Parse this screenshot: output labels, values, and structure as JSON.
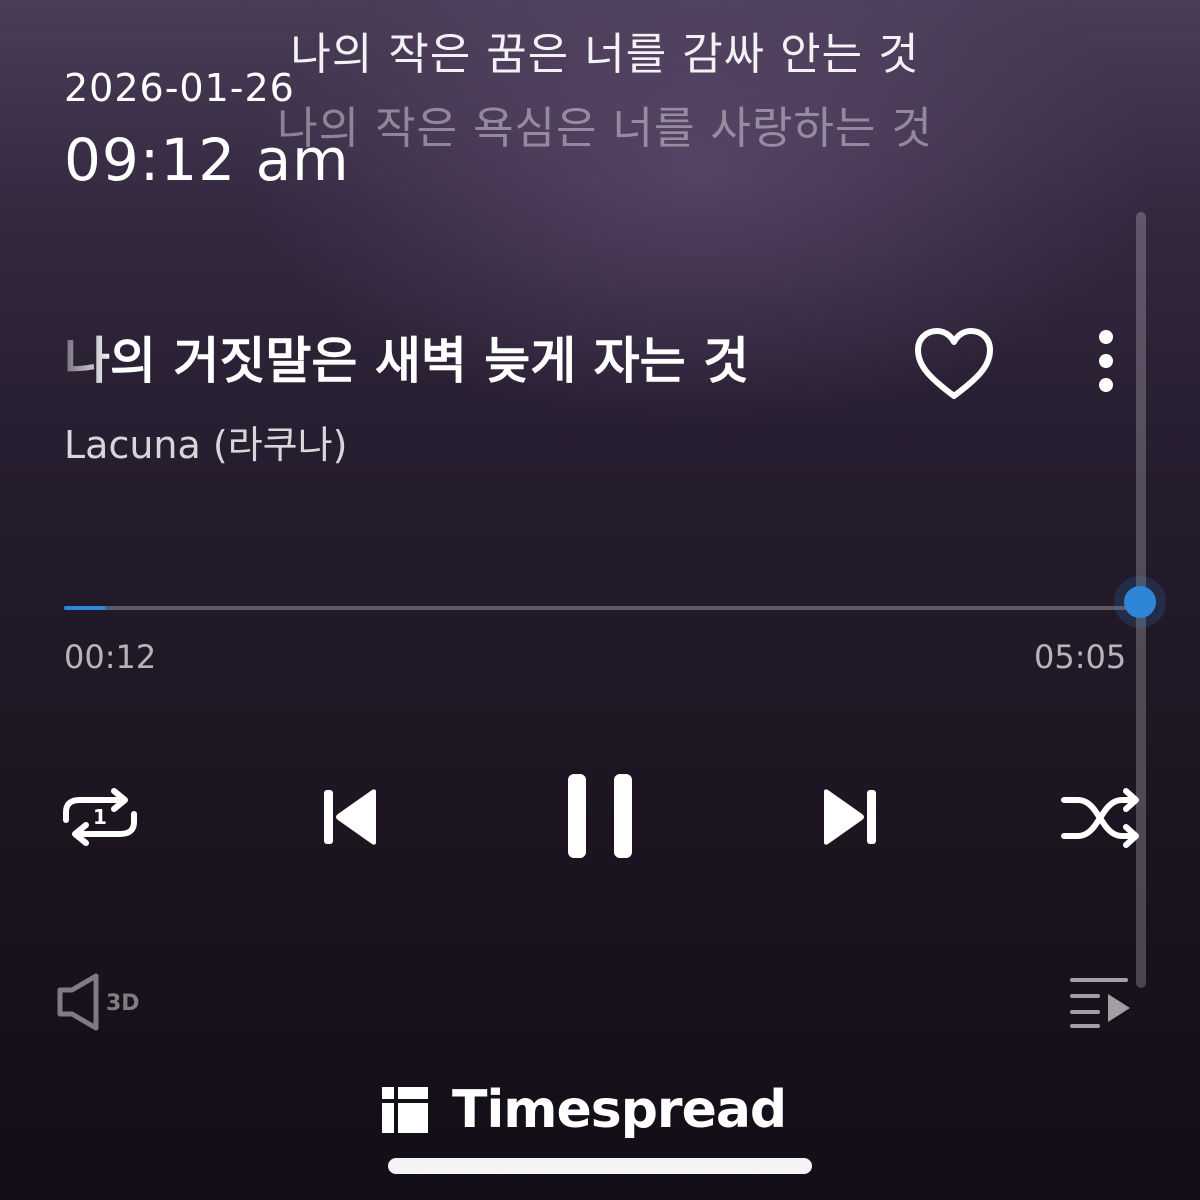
{
  "lyrics": {
    "current_line": "나의 작은 꿈은 너를 감싸 안는 것",
    "next_line": "나의 작은 욕심은 너를 사랑하는 것"
  },
  "overlay": {
    "date": "2026-01-26",
    "time": "09:12 am"
  },
  "track": {
    "title": "나의 거짓말은 새벽 늦게 자는 것",
    "artist": "Lacuna (라쿠나)"
  },
  "playback": {
    "elapsed": "00:12",
    "duration": "05:05",
    "progress_fraction": 0.039,
    "accent_color": "#2f86d8",
    "repeat_mode_badge": "1",
    "state": "playing"
  },
  "controls": {
    "like_icon": "heart-outline-icon",
    "more_icon": "vertical-ellipsis-icon",
    "repeat_icon": "repeat-one-icon",
    "previous_icon": "skip-previous-icon",
    "play_pause_icon": "pause-icon",
    "next_icon": "skip-next-icon",
    "shuffle_icon": "shuffle-icon",
    "sound_effect_label": "3D",
    "queue_icon": "playlist-queue-icon"
  },
  "watermark": {
    "brand": "Timespread"
  }
}
